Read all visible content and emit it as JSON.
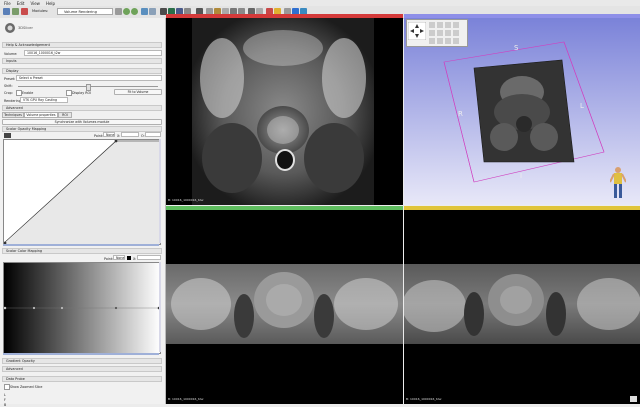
{
  "menu": [
    "File",
    "Edit",
    "View",
    "Help"
  ],
  "toolbar": {
    "modules_label": "Modules:",
    "module_name": "Volume Rendering"
  },
  "panel": {
    "logo_text": "3DSlicer",
    "sections": {
      "help": "Help & Acknowledgement",
      "inputs": "Inputs",
      "display": "Display",
      "advanced": "Advanced",
      "scalar_opacity": "Scalar Opacity Mapping",
      "scalar_color": "Scalar Color Mapping",
      "gradient_opacity": "Gradient Opacity",
      "advanced2": "Advanced",
      "data_probe": "Data Probe"
    },
    "volume_label": "Volume:",
    "volume_value": "10016_1000016_t2w",
    "preset_label": "Preset:",
    "preset_value": "Select a Preset",
    "shift_label": "Shift:",
    "crop_label": "Crop:",
    "enable_label": "Enable",
    "display_roi_label": "Display ROI",
    "fit_label": "Fit to Volume",
    "rendering_label": "Rendering:",
    "rendering_value": "VTK GPU Ray Casting",
    "tabs": [
      "Techniques",
      "Volume properties",
      "ROI"
    ],
    "sync_label": "Synchronize with Volumes module",
    "point_label": "Point:",
    "none_value": "None",
    "x_label": "X:",
    "o_label": "O:",
    "show_zoomed_label": "Show Zoomed Slice",
    "l_label": "L",
    "f_label": "F",
    "b_label": "B"
  },
  "views": {
    "red_label": "B: 10016_1000016_t2w",
    "green_label": "B: 10016_1000016_t2w",
    "yellow_label": "B: 10016_1000016_t2w",
    "orient": {
      "S": "S",
      "R": "R",
      "L": "L",
      "I": "I"
    }
  },
  "colors": {
    "red": "#d43a3a",
    "blue": "#8e8fe8",
    "green": "#5fbd5f",
    "yellow": "#e0c43a",
    "accent": "#2f6fd0"
  }
}
